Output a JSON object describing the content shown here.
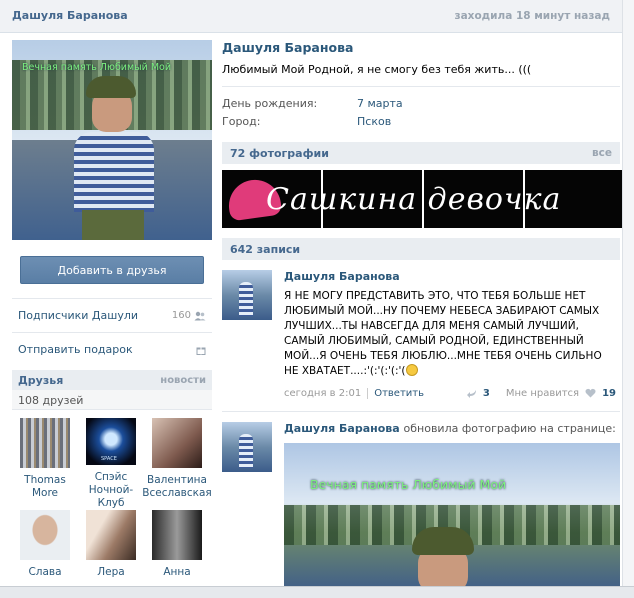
{
  "header": {
    "name": "Дашуля Баранова",
    "last_seen": "заходила 18 минут назад"
  },
  "profile": {
    "avatar_watermark": "Вечная память Любимый Мой",
    "add_friend_label": "Добавить в друзья",
    "followers_label": "Подписчики Дашули",
    "followers_count": "160",
    "gift_label": "Отправить подарок",
    "name": "Дашуля Баранова",
    "status": "Любимый Мой Родной, я не смогу без тебя жить... (((",
    "info": [
      {
        "label": "День рождения:",
        "value": "7 марта"
      },
      {
        "label": "Город:",
        "value": "Псков"
      }
    ]
  },
  "friends": {
    "title": "Друзья",
    "news_link": "новости",
    "count": "108 друзей",
    "items": [
      {
        "name": "Thomas More"
      },
      {
        "name": "Спэйс Ночной-Клуб"
      },
      {
        "name": "Валентина Всеславская"
      },
      {
        "name": "Слава"
      },
      {
        "name": "Лера"
      },
      {
        "name": "Анна"
      }
    ],
    "photo2_label": "SPACE"
  },
  "photos": {
    "title": "72 фотографии",
    "all_link": "все",
    "banner_text": "Сашкина девочка"
  },
  "wall": {
    "title": "642 записи",
    "posts": [
      {
        "author": "Дашуля Баранова",
        "text": "Я НЕ МОГУ ПРЕДСТАВИТЬ ЭТО, ЧТО ТЕБЯ БОЛЬШЕ НЕТ ЛЮБИМЫЙ МОЙ...НУ ПОЧЕМУ НЕБЕСА ЗАБИРАЮТ САМЫХ ЛУЧШИХ...ТЫ НАВСЕГДА ДЛЯ МЕНЯ САМЫЙ ЛУЧШИЙ, САМЫЙ ЛЮБИМЫЙ, САМЫЙ РОДНОЙ, ЕДИНСТВЕННЫЙ МОЙ...Я ОЧЕНЬ ТЕБЯ ЛЮБЛЮ...МНЕ ТЕБЯ ОЧЕНЬ СИЛЬНО НЕ ХВАТАЕТ....:'(:'(:'(:'(",
        "time": "сегодня в 2:01",
        "reply_label": "Ответить",
        "reposts": "3",
        "like_label": "Мне нравится",
        "likes": "19"
      },
      {
        "author": "Дашуля Баранова",
        "action": "обновила фотографию на странице:",
        "photo_watermark": "Вечная память Любимый Мой"
      }
    ]
  },
  "colors": {
    "link": "#2b587a",
    "header_bg": "#e9edf1",
    "button": "#5a7ea5"
  }
}
